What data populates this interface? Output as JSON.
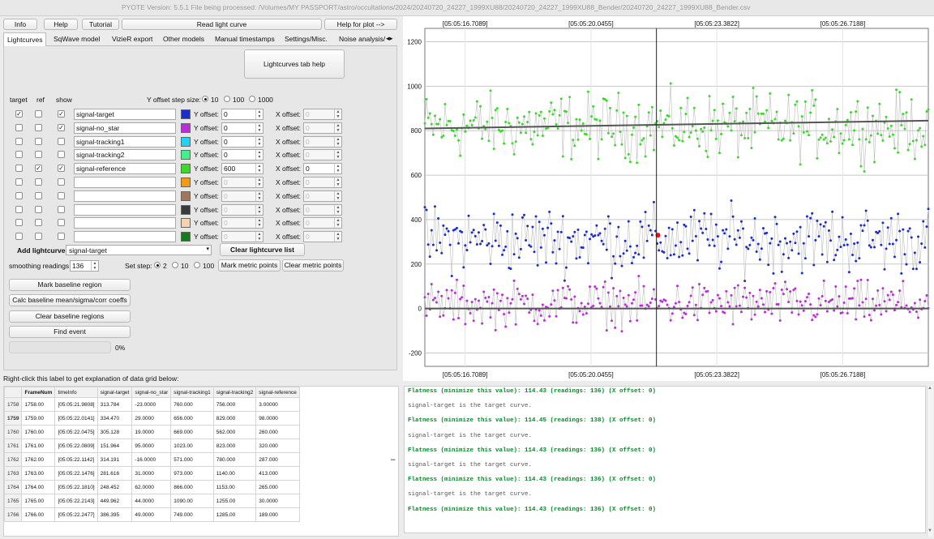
{
  "window_title": "PYOTE Version: 5.5.1  File being processed: /Volumes/MY PASSPORT/astro/occultations/2024/20240720_24227_1999XU88/20240720_24227_1999XU88_Bender/20240720_24227_1999XU88_Bender.csv",
  "top_buttons": {
    "info": "Info",
    "help": "Help",
    "tutorial": "Tutorial",
    "read_light_curve": "Read light curve",
    "help_for_plot": "Help for plot -->"
  },
  "tabs": [
    "Lightcurves",
    "SqWave model",
    "VizieR export",
    "Other models",
    "Manual timestamps",
    "Settings/Misc.",
    "Noise analysis/"
  ],
  "tab_help_button": "Lightcurves tab help",
  "columns": {
    "target": "target",
    "ref": "ref",
    "show": "show"
  },
  "y_offset_step": {
    "label": "Y offset step size:",
    "options": [
      "10",
      "100",
      "1000"
    ],
    "selected": "10"
  },
  "y_offset_label": "Y offset:",
  "x_offset_label": "X offset:",
  "curves": [
    {
      "name": "signal-target",
      "color": "#1c2dc8",
      "target": true,
      "ref": false,
      "show": true,
      "y_offset": "0",
      "x_offset": "0",
      "y_enabled": true,
      "x_enabled": false
    },
    {
      "name": "signal-no_star",
      "color": "#b92ed6",
      "target": false,
      "ref": false,
      "show": true,
      "y_offset": "0",
      "x_offset": "0",
      "y_enabled": true,
      "x_enabled": false
    },
    {
      "name": "signal-tracking1",
      "color": "#22d2f2",
      "target": false,
      "ref": false,
      "show": false,
      "y_offset": "0",
      "x_offset": "0",
      "y_enabled": true,
      "x_enabled": false
    },
    {
      "name": "signal-tracking2",
      "color": "#3ef38a",
      "target": false,
      "ref": false,
      "show": false,
      "y_offset": "0",
      "x_offset": "0",
      "y_enabled": true,
      "x_enabled": false
    },
    {
      "name": "signal-reference",
      "color": "#3ad92a",
      "target": false,
      "ref": true,
      "show": true,
      "y_offset": "600",
      "x_offset": "0",
      "y_enabled": true,
      "x_enabled": true
    },
    {
      "name": "",
      "color": "#f59a12",
      "target": false,
      "ref": false,
      "show": false,
      "y_offset": "0",
      "x_offset": "0",
      "y_enabled": false,
      "x_enabled": false
    },
    {
      "name": "",
      "color": "#a0775a",
      "target": false,
      "ref": false,
      "show": false,
      "y_offset": "0",
      "x_offset": "0",
      "y_enabled": false,
      "x_enabled": false
    },
    {
      "name": "",
      "color": "#3a3a3a",
      "target": false,
      "ref": false,
      "show": false,
      "y_offset": "0",
      "x_offset": "0",
      "y_enabled": false,
      "x_enabled": false
    },
    {
      "name": "",
      "color": "#f7d2ae",
      "target": false,
      "ref": false,
      "show": false,
      "y_offset": "0",
      "x_offset": "0",
      "y_enabled": false,
      "x_enabled": false
    },
    {
      "name": "",
      "color": "#177a1c",
      "target": false,
      "ref": false,
      "show": false,
      "y_offset": "0",
      "x_offset": "0",
      "y_enabled": false,
      "x_enabled": false
    }
  ],
  "add_lightcurve": {
    "label": "Add lightcurve",
    "selected": "signal-target",
    "clear_button": "Clear lightcurve list"
  },
  "smoothing": {
    "label": "smoothing readings",
    "value": "136"
  },
  "set_step": {
    "label": "Set step:",
    "options": [
      "2",
      "10",
      "100"
    ],
    "selected": "2"
  },
  "metric_buttons": {
    "mark": "Mark metric points",
    "clear": "Clear metric points"
  },
  "action_buttons": [
    "Mark baseline region",
    "Calc baseline mean/sigma/corr coeffs",
    "Clear baseline regions",
    "Find event"
  ],
  "progress": {
    "value": 0,
    "text": "0%"
  },
  "grid_hint": "Right-click this label to get explanation of data grid below:",
  "grid": {
    "headers": [
      "FrameNum",
      "timeInfo",
      "signal-target",
      "signal-no_star",
      "signal-tracking1",
      "signal-tracking2",
      "signal-reference"
    ],
    "rows": [
      [
        "1758",
        "1758.00",
        "[05:05:21.9808]",
        "313.784",
        "-23.0000",
        "760.000",
        "756.000",
        "3.00000"
      ],
      [
        "1759",
        "1759.00",
        "[05:05:22.0141]",
        "334.470",
        "29.0000",
        "656.000",
        "829.000",
        "98.0000"
      ],
      [
        "1760",
        "1760.00",
        "[05:05:22.0475]",
        "305.128",
        "19.0000",
        "669.000",
        "562.000",
        "260.000"
      ],
      [
        "1761",
        "1761.00",
        "[05:05:22.0809]",
        "151.964",
        "95.0000",
        "1023.00",
        "823.000",
        "320.000"
      ],
      [
        "1762",
        "1762.00",
        "[05:05:22.1142]",
        "314.191",
        "-16.0000",
        "571.000",
        "780.000",
        "287.000"
      ],
      [
        "1763",
        "1763.00",
        "[05:05:22.1476]",
        "281.616",
        "31.0000",
        "973.000",
        "1140.00",
        "413.000"
      ],
      [
        "1764",
        "1764.00",
        "[05:05:22.1810]",
        "248.452",
        "62.0000",
        "866.000",
        "1153.00",
        "265.000"
      ],
      [
        "1765",
        "1765.00",
        "[05:05:22.2143]",
        "449.962",
        "44.0000",
        "1090.00",
        "1255.00",
        "30.0000"
      ],
      [
        "1766",
        "1766.00",
        "[05:05:22.2477]",
        "386.395",
        "49.0000",
        "749.000",
        "1285.00",
        "189.000"
      ]
    ]
  },
  "log_lines": [
    {
      "text": "Flatness (minimize this value): 114.43 (readings: 136) (X offset: 0)",
      "style": "green"
    },
    {
      "text": "signal-target is the target curve.",
      "style": "gray"
    },
    {
      "text": "Flatness (minimize this value): 114.45 (readings: 138) (X offset: 0)",
      "style": "green"
    },
    {
      "text": "signal-target is the target curve.",
      "style": "gray"
    },
    {
      "text": "Flatness (minimize this value): 114.43 (readings: 136) (X offset: 0)",
      "style": "green"
    },
    {
      "text": "signal-target is the target curve.",
      "style": "gray"
    },
    {
      "text": "Flatness (minimize this value): 114.43 (readings: 136) (X offset: 0)",
      "style": "green"
    },
    {
      "text": "signal-target is the target curve.",
      "style": "gray"
    },
    {
      "text": "Flatness (minimize this value): 114.43 (readings: 136) (X offset: 0)",
      "style": "green"
    }
  ],
  "chart_data": {
    "type": "scatter",
    "x_tick_labels": [
      "[05:05:16.7089]",
      "[05:05:20.0455]",
      "[05:05:23.3822]",
      "[05:05:26.7188]"
    ],
    "y_ticks": [
      -200,
      0,
      200,
      400,
      600,
      800,
      1000,
      1200
    ],
    "ylim": [
      -260,
      1260
    ],
    "xlim": [
      0,
      100
    ],
    "cursor_x": 46,
    "series": [
      {
        "name": "signal-reference",
        "color": "#3ad92a",
        "mean": 820,
        "spread": 110,
        "trend": [
          810,
          845
        ]
      },
      {
        "name": "signal-target",
        "color": "#1c2dc8",
        "mean": 310,
        "spread": 110,
        "marker": {
          "x": 46.3,
          "y": 330,
          "color": "#e11"
        }
      },
      {
        "name": "signal-no_star",
        "color": "#b92ed6",
        "mean": 20,
        "spread": 75,
        "trend": [
          0,
          0
        ]
      }
    ],
    "points_per_series": 300,
    "grid": true
  }
}
